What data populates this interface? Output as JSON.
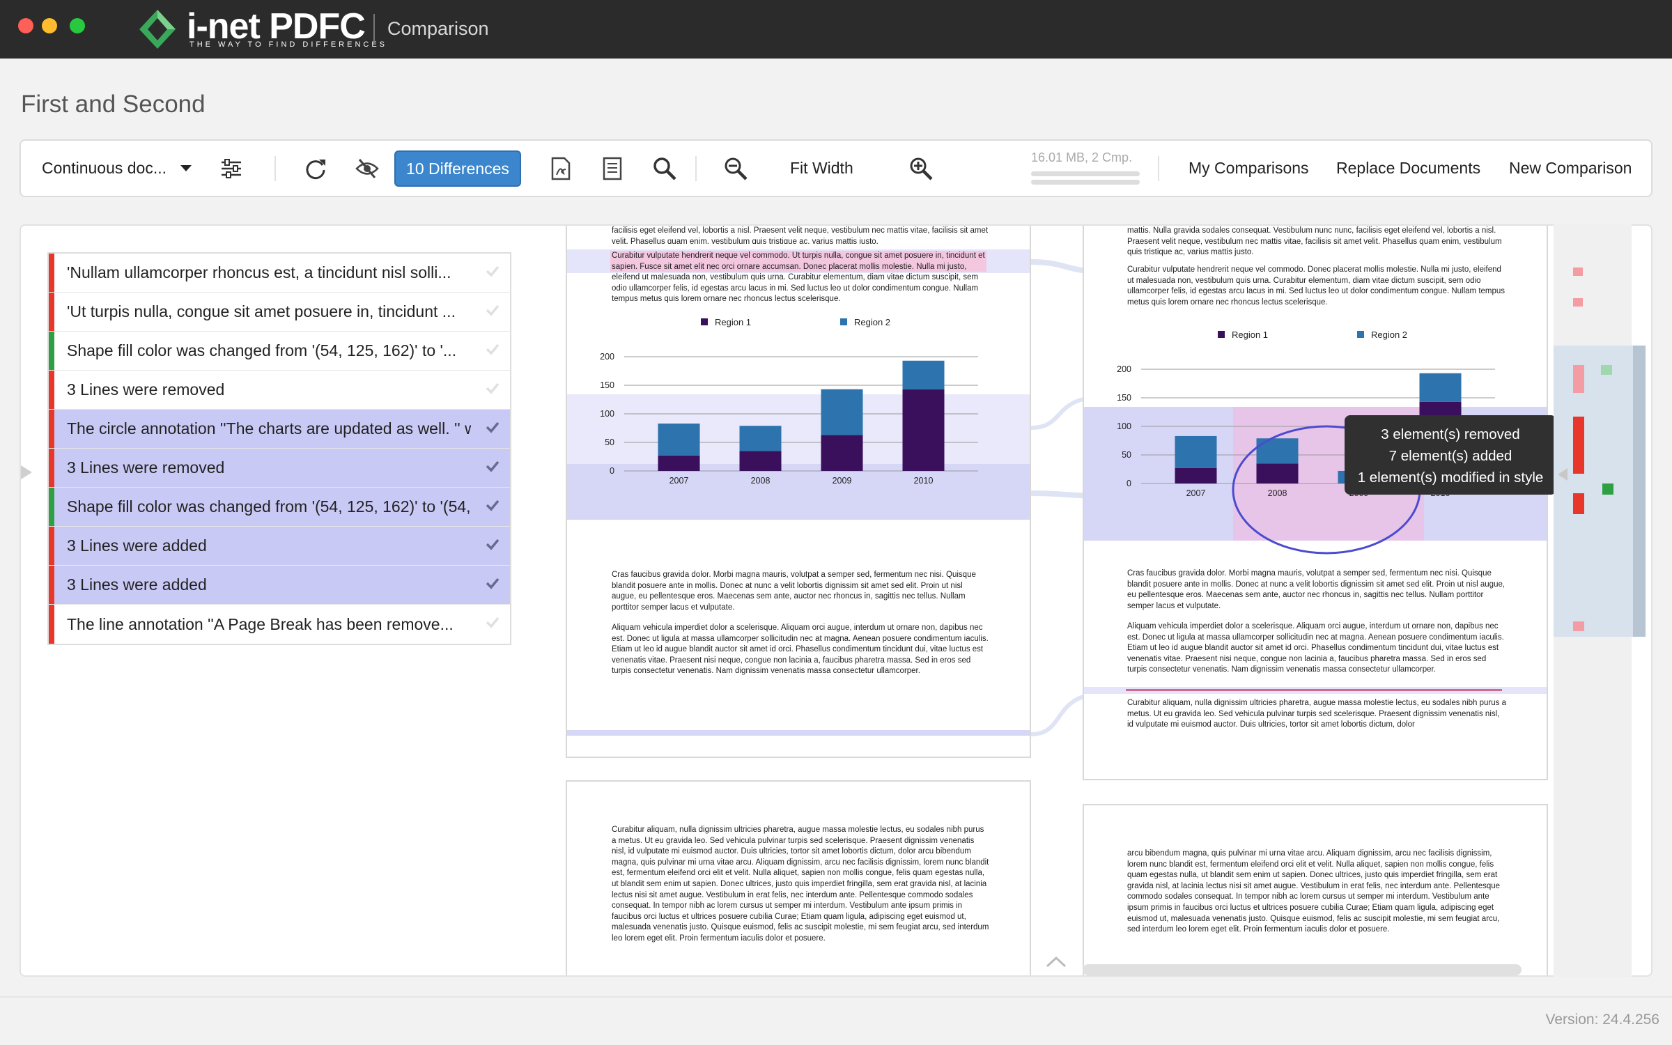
{
  "window": {
    "title": "Comparison",
    "brand": "i-net PDFC",
    "tagline": "THE WAY TO FIND DIFFERENCES"
  },
  "document": {
    "title": "First and Second"
  },
  "toolbar": {
    "view_mode": "Continuous doc...",
    "differences_button": "10 Differences",
    "zoom_mode": "Fit Width",
    "memory": "16.01 MB, 2 Cmp.",
    "my_comparisons": "My Comparisons",
    "replace_documents": "Replace Documents",
    "new_comparison": "New Comparison"
  },
  "colors": {
    "removed": "#e8372a",
    "added": "#2ea043",
    "selected": "#c9c9f6",
    "accent": "#3b86cc"
  },
  "differences": [
    {
      "text": "'Nullam ullamcorper rhoncus est, a tincidunt nisl solli...",
      "type": "removed",
      "selected": false
    },
    {
      "text": "'Ut turpis nulla, congue sit amet posuere in, tincidunt ...",
      "type": "removed",
      "selected": false
    },
    {
      "text": "Shape fill color was changed from '(54, 125, 162)' to '...",
      "type": "added",
      "selected": false
    },
    {
      "text": "3 Lines were removed",
      "type": "removed",
      "selected": false
    },
    {
      "text": "The circle annotation ''The charts are updated as well. '' w",
      "type": "removed",
      "selected": true
    },
    {
      "text": "3 Lines were removed",
      "type": "removed",
      "selected": true
    },
    {
      "text": "Shape fill color was changed from '(54, 125, 162)' to '(54,",
      "type": "added",
      "selected": true
    },
    {
      "text": "3 Lines were added",
      "type": "removed",
      "selected": true
    },
    {
      "text": "3 Lines were added",
      "type": "removed",
      "selected": true
    },
    {
      "text": "The line annotation ''A Page Break has been remove...",
      "type": "removed",
      "selected": false
    }
  ],
  "tooltip": {
    "line1": "3 element(s) removed",
    "line2": "7 element(s) added",
    "line3": "1 element(s) modified in style"
  },
  "left_page": {
    "top_text": "facilisis eget eleifend vel, lobortis a nisl. Praesent velit neque, vestibulum nec mattis vitae, facilisis sit amet velit. Phasellus quam enim, vestibulum quis tristique ac, varius mattis justo.",
    "para1_a": "Curabitur vulputate hendrerit neque vel commodo.",
    "para1_b": "Ut turpis nulla, congue sit amet posuere in, tincidunt et sapien. Fusce sit amet elit nec orci ornare accumsan.",
    "para1_c": "Donec placerat mollis molestie. Nulla mi justo, eleifend ut malesuada non, vestibulum quis urna. Curabitur elementum, diam vitae dictum suscipit, sem odio ullamcorper felis, id egestas arcu lacus in mi. Sed luctus leo ut dolor condimentum congue. Nullam tempus metus quis lorem ornare nec rhoncus lectus scelerisque.",
    "para2": "Cras faucibus gravida dolor. Morbi magna mauris, volutpat a semper sed, fermentum nec nisi. Quisque blandit posuere ante in mollis. Donec at nunc a velit lobortis dignissim sit amet sed elit. Proin ut nisl augue, eu pellentesque eros. Maecenas sem ante, auctor nec rhoncus in, sagittis nec tellus. Nullam porttitor semper lacus et vulputate.",
    "para3": "Aliquam vehicula imperdiet dolor a scelerisque. Aliquam orci augue, interdum ut ornare non, dapibus nec est. Donec ut ligula at massa ullamcorper sollicitudin nec at magna. Aenean posuere condimentum iaculis. Etiam ut leo id augue blandit auctor sit amet id orci. Phasellus condimentum tincidunt dui, vitae luctus est venenatis vitae. Praesent nisi neque, congue non lacinia a, faucibus pharetra massa. Sed in eros sed turpis consectetur venenatis. Nam dignissim venenatis massa consectetur ullamcorper."
  },
  "left_page2": {
    "text": "Curabitur aliquam, nulla dignissim ultricies pharetra, augue massa molestie lectus, eu sodales nibh purus a metus. Ut eu gravida leo. Sed vehicula pulvinar turpis sed scelerisque. Praesent dignissim venenatis nisl, id vulputate mi euismod auctor. Duis ultricies, tortor sit amet lobortis dictum, dolor arcu bibendum magna, quis pulvinar mi urna vitae arcu. Aliquam dignissim, arcu nec facilisis dignissim, lorem nunc blandit est, fermentum eleifend orci elit et velit. Nulla aliquet, sapien non mollis congue, felis quam egestas nulla, ut blandit sem enim ut sapien. Donec ultrices, justo quis imperdiet fringilla, sem erat gravida nisl, at lacinia lectus nisi sit amet augue. Vestibulum in erat felis, nec interdum ante. Pellentesque commodo sodales consequat. In tempor nibh ac lorem cursus ut semper mi interdum. Vestibulum ante ipsum primis in faucibus orci luctus et ultrices posuere cubilia Curae; Etiam quam ligula, adipiscing eget euismod ut, malesuada venenatis justo. Quisque euismod, felis ac suscipit molestie, mi sem feugiat arcu, sed interdum leo lorem eget elit. Proin fermentum iaculis dolor et posuere."
  },
  "right_page": {
    "top_text": "mattis. Nulla gravida sodales consequat. Vestibulum nunc nunc, facilisis eget eleifend vel, lobortis a nisl. Praesent velit neque, vestibulum nec mattis vitae, facilisis sit amet velit. Phasellus quam enim, vestibulum quis tristique ac, varius mattis justo.",
    "para1": "Curabitur vulputate hendrerit neque vel commodo. Donec placerat mollis molestie. Nulla mi justo, eleifend ut malesuada non, vestibulum quis urna. Curabitur elementum, diam vitae dictum suscipit, sem odio ullamcorper felis, id egestas arcu lacus in mi. Sed luctus leo ut dolor condimentum congue. Nullam tempus metus quis lorem ornare nec rhoncus lectus scelerisque.",
    "para2": "Cras faucibus gravida dolor. Morbi magna mauris, volutpat a semper sed, fermentum nec nisi. Quisque blandit posuere ante in mollis. Donec at nunc a velit lobortis dignissim sit amet sed elit. Proin ut nisl augue, eu pellentesque eros. Maecenas sem ante, auctor nec rhoncus in, sagittis nec tellus. Nullam porttitor semper lacus et vulputate.",
    "para3": "Aliquam vehicula imperdiet dolor a scelerisque. Aliquam orci augue, interdum ut ornare non, dapibus nec est. Donec ut ligula at massa ullamcorper sollicitudin nec at magna. Aenean posuere condimentum iaculis. Etiam ut leo id augue blandit auctor sit amet id orci. Phasellus condimentum tincidunt dui, vitae luctus est venenatis vitae. Praesent nisi neque, congue non lacinia a, faucibus pharetra massa. Sed in eros sed turpis consectetur venenatis. Nam dignissim venenatis massa consectetur ullamcorper.",
    "para4": "Curabitur aliquam, nulla dignissim ultricies pharetra, augue massa molestie lectus, eu sodales nibh purus a metus. Ut eu gravida leo. Sed vehicula pulvinar turpis sed scelerisque. Praesent dignissim venenatis nisl, id vulputate mi euismod auctor. Duis ultricies, tortor sit amet lobortis dictum, dolor"
  },
  "right_page2": {
    "text": "arcu bibendum magna, quis pulvinar mi urna vitae arcu. Aliquam dignissim, arcu nec facilisis dignissim, lorem nunc blandit est, fermentum eleifend orci elit et velit. Nulla aliquet, sapien non mollis congue, felis quam egestas nulla, ut blandit sem enim ut sapien. Donec ultrices, justo quis imperdiet fringilla, sem erat gravida nisl, at lacinia lectus nisi sit amet augue. Vestibulum in erat felis, nec interdum ante. Pellentesque commodo sodales consequat. In tempor nibh ac lorem cursus ut semper mi interdum. Vestibulum ante ipsum primis in faucibus orci luctus et ultrices posuere cubilia Curae; Etiam quam ligula, adipiscing eget euismod ut, malesuada venenatis justo. Quisque euismod, felis ac suscipit molestie, mi sem feugiat arcu, sed interdum leo lorem eget elit. Proin fermentum iaculis dolor et posuere."
  },
  "chart_data": [
    {
      "type": "bar",
      "categories": [
        "2007",
        "2008",
        "2009",
        "2010"
      ],
      "series": [
        {
          "name": "Region 1",
          "values": [
            27,
            35,
            63,
            143
          ],
          "color": "#3a0f5c"
        },
        {
          "name": "Region 2",
          "values": [
            56,
            44,
            80,
            50
          ],
          "color": "#2d73ad"
        }
      ],
      "stacked": true,
      "ylim": [
        0,
        200
      ],
      "yticks": [
        "0",
        "50",
        "100",
        "150",
        "200"
      ],
      "legend": "top"
    },
    {
      "type": "bar",
      "categories": [
        "2007",
        "2008",
        "2009",
        "2010"
      ],
      "series": [
        {
          "name": "Region 1",
          "values": [
            27,
            35,
            0,
            143
          ],
          "color": "#3a0f5c"
        },
        {
          "name": "Region 2",
          "values": [
            56,
            44,
            22,
            50
          ],
          "color": "#2d73ad"
        }
      ],
      "stacked": true,
      "ylim": [
        0,
        200
      ],
      "yticks": [
        "0",
        "50",
        "100",
        "150",
        "200"
      ],
      "legend": "top"
    }
  ],
  "version": "Version: 24.4.256"
}
